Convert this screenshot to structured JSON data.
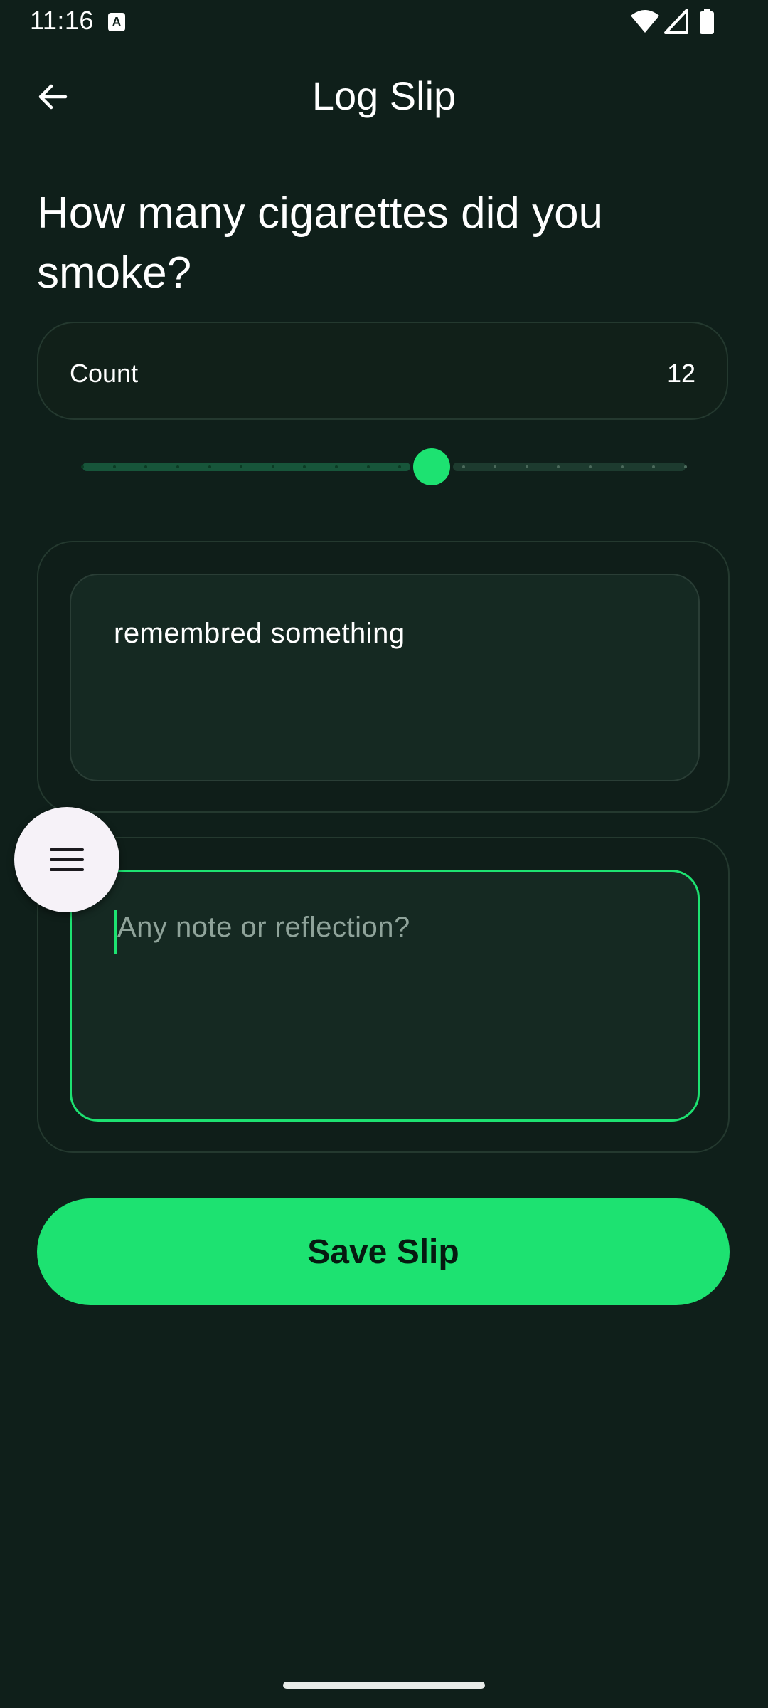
{
  "status_bar": {
    "time": "11:16",
    "notification_icon_letter": "A",
    "icons": [
      "wifi-icon",
      "signal-icon",
      "battery-icon"
    ]
  },
  "app_bar": {
    "title": "Log Slip",
    "back_icon": "arrow-left-icon"
  },
  "question": "How many cigarettes did you smoke?",
  "count": {
    "label": "Count",
    "value": "12"
  },
  "slider": {
    "min": 1,
    "max": 20,
    "value": 12,
    "accent": "#1de271"
  },
  "reason_field": {
    "value": "remembred something"
  },
  "note_field": {
    "value": "",
    "placeholder": "Any note or reflection?"
  },
  "menu_button": {
    "icon": "menu-icon"
  },
  "save_button": {
    "label": "Save Slip"
  },
  "colors": {
    "background": "#0f1f1a",
    "accent": "#1de271",
    "card_border": "#24392f"
  }
}
